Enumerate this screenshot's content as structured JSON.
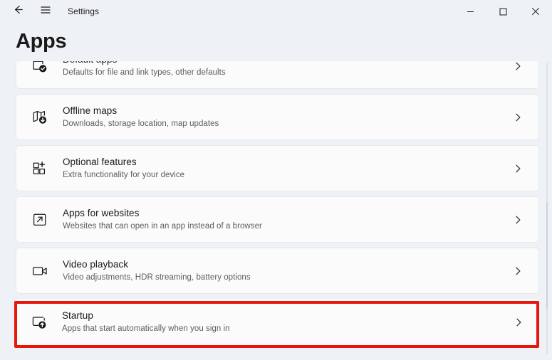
{
  "titlebar": {
    "back_icon": "back-arrow-icon",
    "menu_icon": "hamburger-menu-icon",
    "title": "Settings",
    "minimize_label": "—",
    "maximize_label": "□",
    "close_label": "✕"
  },
  "page": {
    "heading": "Apps"
  },
  "settings_list": [
    {
      "id": "default-apps",
      "icon": "default-apps-icon",
      "title": "Default apps",
      "subtitle": "Defaults for file and link types, other defaults",
      "chevron": "chevron-right-icon",
      "highlighted": false
    },
    {
      "id": "offline-maps",
      "icon": "offline-maps-icon",
      "title": "Offline maps",
      "subtitle": "Downloads, storage location, map updates",
      "chevron": "chevron-right-icon",
      "highlighted": false
    },
    {
      "id": "optional-features",
      "icon": "optional-features-icon",
      "title": "Optional features",
      "subtitle": "Extra functionality for your device",
      "chevron": "chevron-right-icon",
      "highlighted": false
    },
    {
      "id": "apps-for-websites",
      "icon": "apps-for-websites-icon",
      "title": "Apps for websites",
      "subtitle": "Websites that can open in an app instead of a browser",
      "chevron": "chevron-right-icon",
      "highlighted": false
    },
    {
      "id": "video-playback",
      "icon": "video-playback-icon",
      "title": "Video playback",
      "subtitle": "Video adjustments, HDR streaming, battery options",
      "chevron": "chevron-right-icon",
      "highlighted": false
    },
    {
      "id": "startup",
      "icon": "startup-icon",
      "title": "Startup",
      "subtitle": "Apps that start automatically when you sign in",
      "chevron": "chevron-right-icon",
      "highlighted": true
    }
  ],
  "colors": {
    "highlight_border": "#e8160c",
    "page_background": "#eef1f5",
    "card_background": "#fbfbfb",
    "title_text": "#1a1a1a",
    "subtitle_text": "#5d5d5d"
  }
}
